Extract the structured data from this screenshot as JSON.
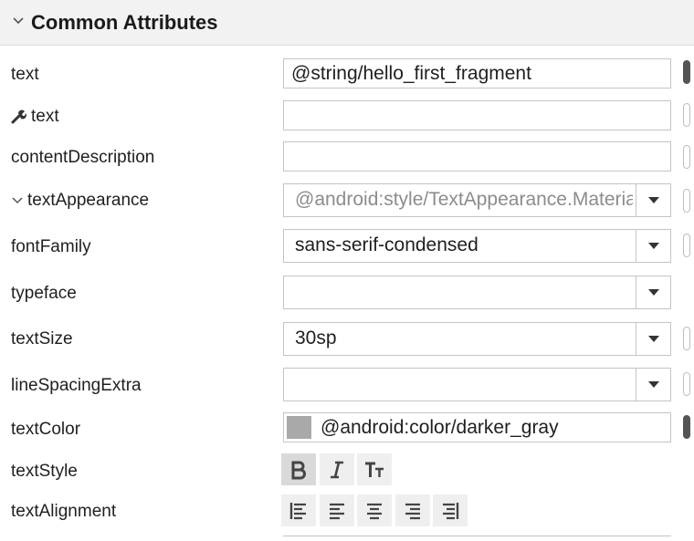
{
  "section": {
    "title": "Common Attributes",
    "icon": "chevron-down-icon"
  },
  "rows": {
    "text": {
      "label": "text",
      "value": "@string/hello_first_fragment"
    },
    "tools_text": {
      "label": "text",
      "icon": "wrench-icon",
      "value": ""
    },
    "content_description": {
      "label": "contentDescription",
      "value": ""
    },
    "text_appearance": {
      "label": "textAppearance",
      "icon": "chevron-down-icon",
      "value": "@android:style/TextAppearance.Material.Small"
    },
    "font_family": {
      "label": "fontFamily",
      "value": "sans-serif-condensed"
    },
    "typeface": {
      "label": "typeface",
      "value": ""
    },
    "text_size": {
      "label": "textSize",
      "value": "30sp"
    },
    "line_spacing_extra": {
      "label": "lineSpacingExtra",
      "value": ""
    },
    "text_color": {
      "label": "textColor",
      "value": "@android:color/darker_gray",
      "swatch": "#a9a9a9"
    },
    "text_style": {
      "label": "textStyle",
      "buttons": [
        "bold-icon",
        "italic-icon",
        "all-caps-icon"
      ],
      "active": "bold-icon"
    },
    "text_alignment": {
      "label": "textAlignment",
      "buttons": [
        "align-start-icon",
        "align-left-icon",
        "align-center-icon",
        "align-right-icon",
        "align-end-icon"
      ]
    }
  },
  "colors": {
    "header_bg": "#f2f2f2",
    "border": "#c4c4c4",
    "swatch": "#a9a9a9"
  }
}
